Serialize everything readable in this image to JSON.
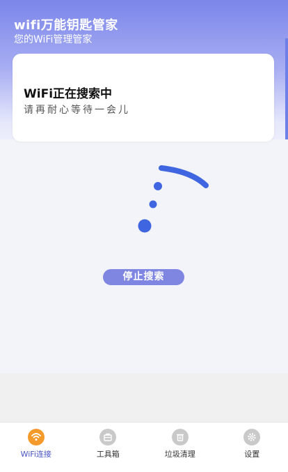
{
  "header": {
    "title": "wifi万能钥匙管家",
    "subtitle": "您的WiFi管理管家"
  },
  "status_card": {
    "title": "WiFi正在搜索中",
    "subtitle": "请再耐心等待一会儿"
  },
  "search": {
    "stop_label": "停止搜索",
    "animation_icon": "wifi-signal-icon"
  },
  "bottom_nav": {
    "items": [
      {
        "label": "WiFi连接",
        "icon": "wifi-icon",
        "active": true
      },
      {
        "label": "工具箱",
        "icon": "toolbox-icon",
        "active": false
      },
      {
        "label": "垃圾清理",
        "icon": "trash-icon",
        "active": false
      },
      {
        "label": "设置",
        "icon": "gear-icon",
        "active": false
      }
    ]
  },
  "colors": {
    "accent": "#6f7fe8",
    "button": "#7f86e2",
    "wifi_animation": "#3f66e0",
    "nav_active_icon": "#f49a2a",
    "nav_inactive_icon": "#c9c9c9"
  }
}
